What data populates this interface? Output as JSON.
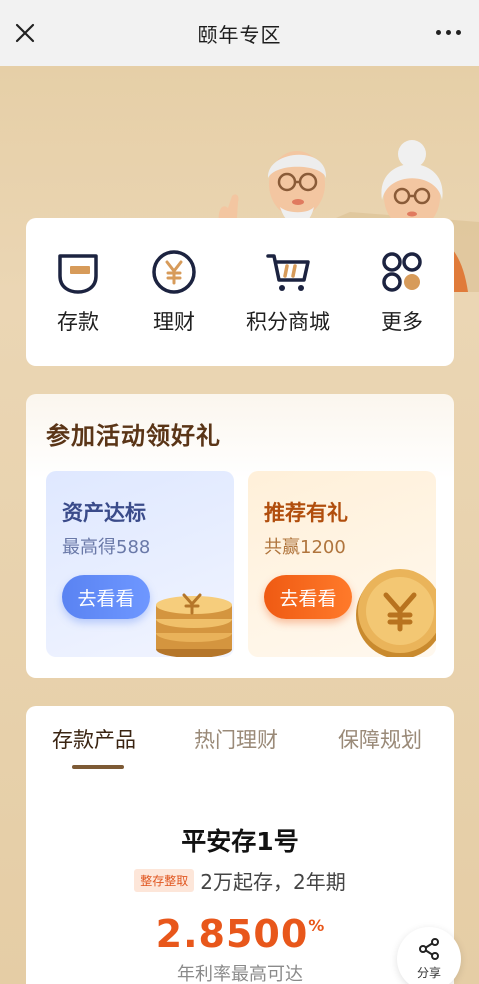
{
  "nav": {
    "title": "颐年专区",
    "close_icon": "close-icon",
    "more_icon": "more-icon"
  },
  "quick": [
    {
      "label": "存款",
      "icon": "deposit-card-icon"
    },
    {
      "label": "理财",
      "icon": "yuan-coin-icon"
    },
    {
      "label": "积分商城",
      "icon": "cart-icon"
    },
    {
      "label": "更多",
      "icon": "more-grid-icon"
    }
  ],
  "activity": {
    "title": "参加活动领好礼",
    "cards": [
      {
        "title": "资产达标",
        "subtitle": "最高得588",
        "button": "去看看"
      },
      {
        "title": "推荐有礼",
        "subtitle": "共赢1200",
        "button": "去看看"
      }
    ]
  },
  "product": {
    "tabs": [
      "存款产品",
      "热门理财",
      "保障规划"
    ],
    "active_tab": 0,
    "name": "平安存1号",
    "tag": "整存整取",
    "desc": "2万起存，2年期",
    "rate": "2.8500",
    "rate_unit": "%",
    "rate_label": "年利率最高可达"
  },
  "share": {
    "label": "分享"
  },
  "colors": {
    "accent_orange": "#e8571b",
    "brown_title": "#5a3517",
    "blue_button": "#5a83f2",
    "orange_button": "#ef5a13"
  }
}
